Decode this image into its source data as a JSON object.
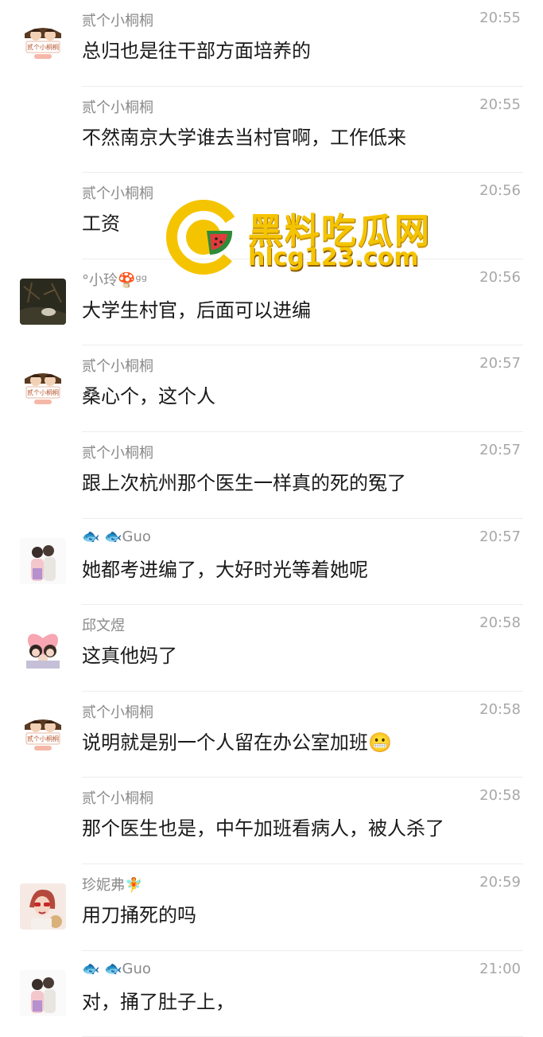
{
  "watermark": {
    "title": "黑料吃瓜网",
    "url": "hlcg123.com"
  },
  "messages": [
    {
      "sender": "贰个小桐桐",
      "time": "20:55",
      "text": "总归也是往干部方面培养的",
      "avatar": "cartoon-couple",
      "show_avatar": true
    },
    {
      "sender": "贰个小桐桐",
      "time": "20:55",
      "text": "不然南京大学谁去当村官啊，工作低来",
      "avatar": "cartoon-couple",
      "show_avatar": false
    },
    {
      "sender": "贰个小桐桐",
      "time": "20:56",
      "text": "工资",
      "avatar": "cartoon-couple",
      "show_avatar": false
    },
    {
      "sender": "°小玲🍄ᵍᵍ",
      "time": "20:56",
      "text": "大学生村官，后面可以进编",
      "avatar": "landscape-photo",
      "show_avatar": true
    },
    {
      "sender": "贰个小桐桐",
      "time": "20:57",
      "text": "桑心个，这个人",
      "avatar": "cartoon-couple",
      "show_avatar": true
    },
    {
      "sender": "贰个小桐桐",
      "time": "20:57",
      "text": "跟上次杭州那个医生一样真的死的冤了",
      "avatar": "cartoon-couple",
      "show_avatar": false
    },
    {
      "sender": "🐟 🐟Guo",
      "time": "20:57",
      "text": "她都考进编了，大好时光等着她呢",
      "avatar": "couple-photo",
      "show_avatar": true
    },
    {
      "sender": "邱文煜",
      "time": "20:58",
      "text": "这真他妈了",
      "avatar": "cartoon-family",
      "show_avatar": true
    },
    {
      "sender": "贰个小桐桐",
      "time": "20:58",
      "text": "说明就是别一个人留在办公室加班😬",
      "avatar": "cartoon-couple",
      "show_avatar": true
    },
    {
      "sender": "贰个小桐桐",
      "time": "20:58",
      "text": "那个医生也是，中午加班看病人，被人杀了",
      "avatar": "cartoon-couple",
      "show_avatar": false
    },
    {
      "sender": "珍妮弗🧚",
      "time": "20:59",
      "text": "用刀捅死的吗",
      "avatar": "woman-sunglasses",
      "show_avatar": true
    },
    {
      "sender": "🐟 🐟Guo",
      "time": "21:00",
      "text": "对，捅了肚子上，",
      "avatar": "couple-photo",
      "show_avatar": true
    }
  ]
}
